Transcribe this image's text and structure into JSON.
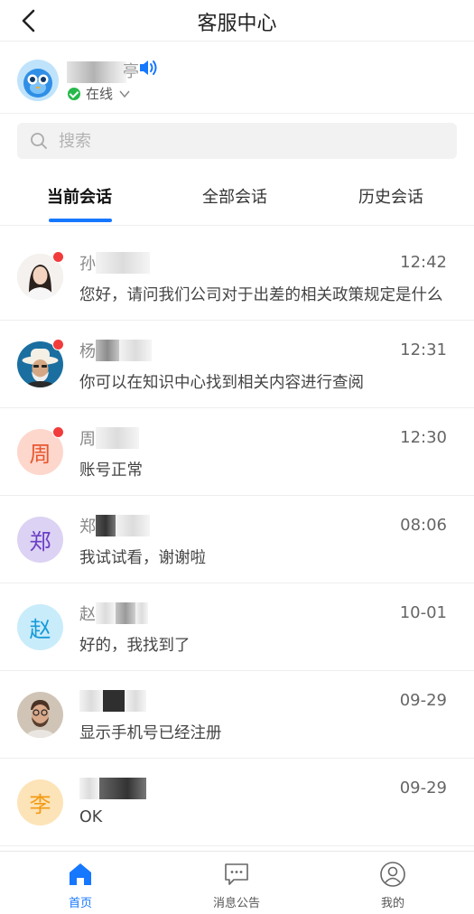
{
  "header": {
    "title": "客服中心",
    "back_icon": "chevron-left-icon"
  },
  "profile": {
    "name_suffix": "亭",
    "status": "在线",
    "status_color": "#26b94a",
    "speaker_icon": "speaker-icon"
  },
  "search": {
    "placeholder": "搜索"
  },
  "tabs": [
    {
      "label": "当前会话",
      "active": true
    },
    {
      "label": "全部会话",
      "active": false
    },
    {
      "label": "历史会话",
      "active": false
    }
  ],
  "conversations": [
    {
      "name_visible": "孙",
      "time": "12:42",
      "message": "您好，请问我们公司对于出差的相关政策规定是什么",
      "unread": true,
      "avatar": "photo-woman"
    },
    {
      "name_visible": "杨",
      "time": "12:31",
      "message": "你可以在知识中心找到相关内容进行查阅",
      "unread": true,
      "avatar": "photo-man-hat"
    },
    {
      "name_visible": "周",
      "time": "12:30",
      "message": "账号正常",
      "unread": true,
      "avatar_text": "周",
      "avatar_bg": "#fdd6cc",
      "avatar_fg": "#e8562e"
    },
    {
      "name_visible": "郑",
      "time": "08:06",
      "message": "我试试看，谢谢啦",
      "unread": false,
      "avatar_text": "郑",
      "avatar_bg": "#dcd2f3",
      "avatar_fg": "#6a3fc4"
    },
    {
      "name_visible": "赵",
      "time": "10-01",
      "message": "好的，我找到了",
      "unread": false,
      "avatar_text": "赵",
      "avatar_bg": "#c9ecfb",
      "avatar_fg": "#179ad8"
    },
    {
      "name_visible": "",
      "time": "09-29",
      "message": "显示手机号已经注册",
      "unread": false,
      "avatar": "photo-man-glasses"
    },
    {
      "name_visible": "",
      "time": "09-29",
      "message": "OK",
      "unread": false,
      "avatar_text": "李",
      "avatar_bg": "#fde3b8",
      "avatar_fg": "#f39a12"
    }
  ],
  "tabbar": [
    {
      "label": "首页",
      "icon": "home-icon",
      "active": true
    },
    {
      "label": "消息公告",
      "icon": "message-icon",
      "active": false
    },
    {
      "label": "我的",
      "icon": "user-icon",
      "active": false
    }
  ],
  "colors": {
    "accent": "#1677ff",
    "badge": "#f23b3b"
  }
}
